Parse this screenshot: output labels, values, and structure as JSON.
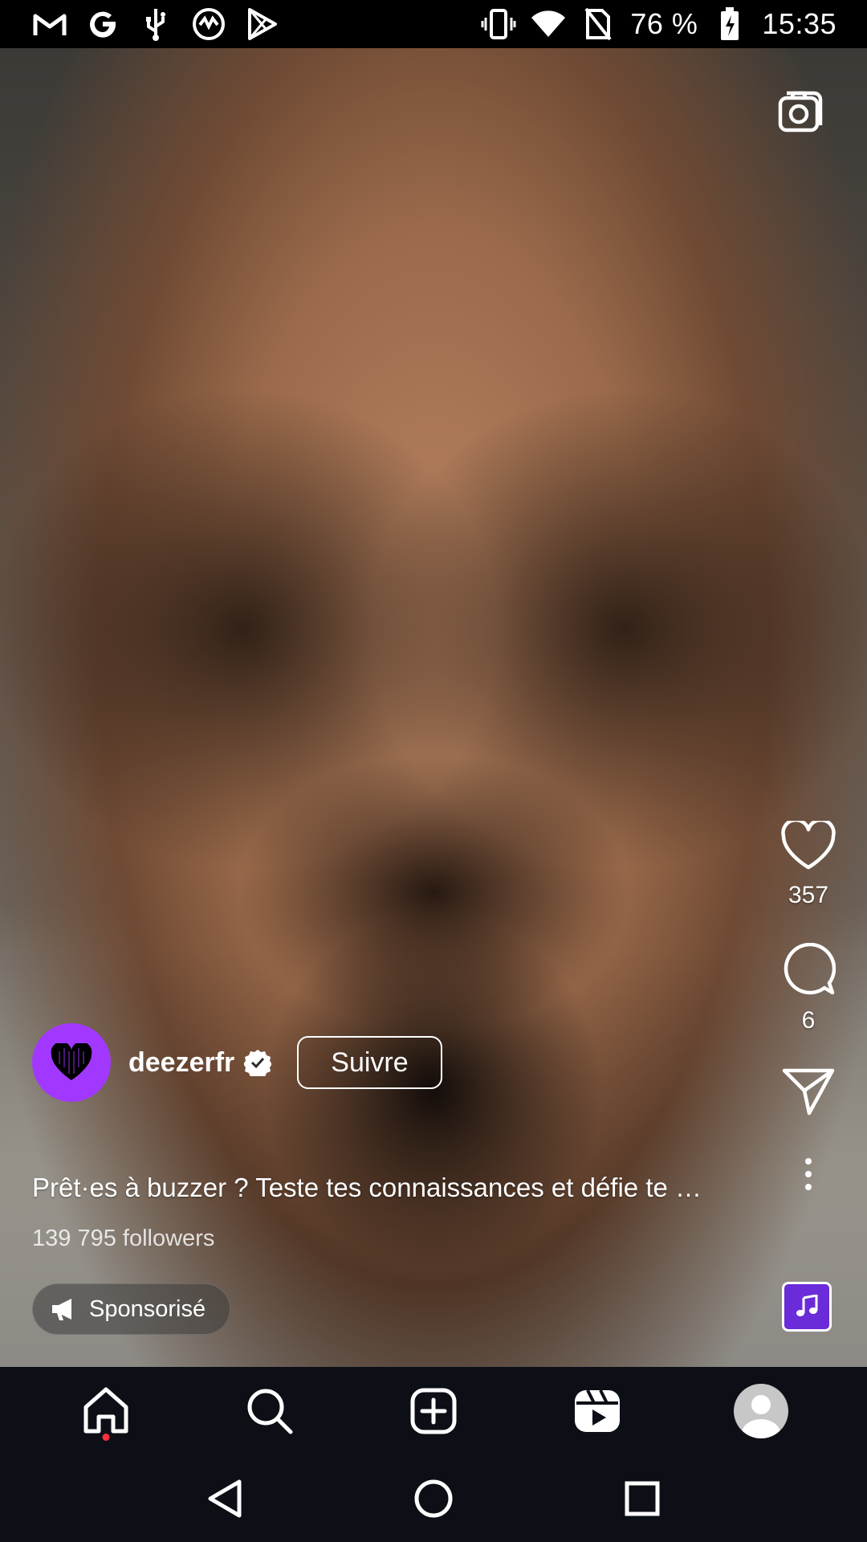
{
  "status_bar": {
    "battery_percent": "76 %",
    "time": "15:35",
    "left_icons": [
      "gmail-icon",
      "google-icon",
      "usb-icon",
      "vpn-icon",
      "play-store-icon"
    ],
    "right_icons": [
      "vibrate-icon",
      "wifi-icon",
      "no-sim-icon",
      "battery-charging-icon"
    ]
  },
  "post": {
    "username": "deezerfr",
    "verified": true,
    "follow_label": "Suivre",
    "caption": "Prêt·es à buzzer ? Teste tes connaissances et défie te …",
    "followers": "139 795 followers",
    "sponsored_label": "Sponsorisé"
  },
  "actions": {
    "likes": "357",
    "comments": "6"
  },
  "colors": {
    "avatar_bg": "#a238ff",
    "music_thumb_bg": "#6a2bd9",
    "nav_bg": "#0c0f16",
    "notif_dot": "#ff3040"
  },
  "bottom_nav": {
    "items": [
      "home-icon",
      "search-icon",
      "create-icon",
      "reels-icon",
      "profile-icon"
    ]
  },
  "system_nav": {
    "items": [
      "back-icon",
      "home-circle-icon",
      "recents-icon"
    ]
  }
}
